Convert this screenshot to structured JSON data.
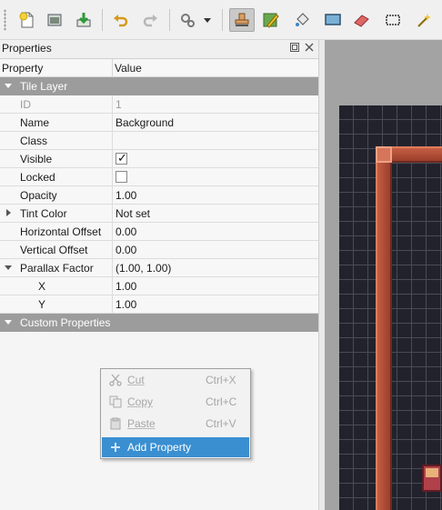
{
  "toolbar": {
    "buttons": [
      {
        "name": "new-icon"
      },
      {
        "name": "open-icon"
      },
      {
        "name": "save-icon"
      },
      {
        "name": "undo-icon"
      },
      {
        "name": "redo-icon"
      },
      {
        "name": "command-icon"
      },
      {
        "name": "stamp-brush-icon",
        "active": true
      },
      {
        "name": "terrain-brush-icon"
      },
      {
        "name": "bucket-fill-icon"
      },
      {
        "name": "shape-fill-icon"
      },
      {
        "name": "eraser-icon"
      },
      {
        "name": "rect-select-icon"
      },
      {
        "name": "magic-wand-icon"
      }
    ]
  },
  "panel": {
    "title": "Properties",
    "header": {
      "property": "Property",
      "value": "Value"
    },
    "groups": {
      "tile_layer": "Tile Layer",
      "custom": "Custom Properties"
    },
    "props": {
      "id": {
        "name": "ID",
        "value": "1"
      },
      "name": {
        "name": "Name",
        "value": "Background"
      },
      "class": {
        "name": "Class",
        "value": ""
      },
      "visible": {
        "name": "Visible",
        "checked": true
      },
      "locked": {
        "name": "Locked",
        "checked": false
      },
      "opacity": {
        "name": "Opacity",
        "value": "1.00"
      },
      "tint": {
        "name": "Tint Color",
        "value": "Not set"
      },
      "hoffset": {
        "name": "Horizontal Offset",
        "value": "0.00"
      },
      "voffset": {
        "name": "Vertical Offset",
        "value": "0.00"
      },
      "parallax": {
        "name": "Parallax Factor",
        "value": "(1.00, 1.00)"
      },
      "px": {
        "name": "X",
        "value": "1.00"
      },
      "py": {
        "name": "Y",
        "value": "1.00"
      }
    }
  },
  "context_menu": {
    "cut": {
      "label": "Cut",
      "shortcut": "Ctrl+X"
    },
    "copy": {
      "label": "Copy",
      "shortcut": "Ctrl+C"
    },
    "paste": {
      "label": "Paste",
      "shortcut": "Ctrl+V"
    },
    "add": {
      "label": "Add Property"
    }
  },
  "colors": {
    "accent": "#3a8fd1",
    "group_bg": "#9c9c9c",
    "map_bg": "#22222d",
    "wall": "#b24d38"
  }
}
